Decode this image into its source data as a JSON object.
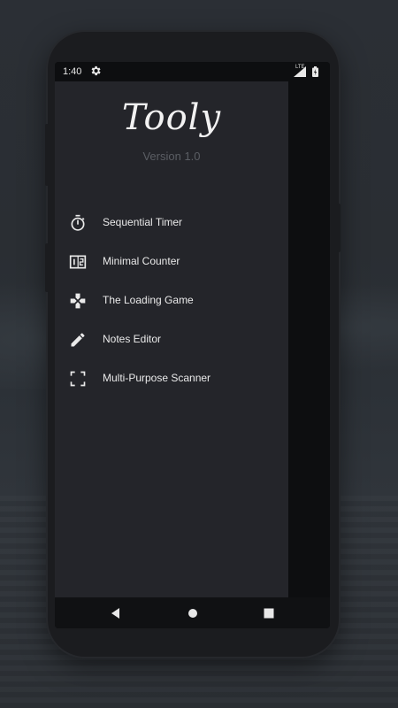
{
  "status": {
    "time": "1:40",
    "network": "LTE"
  },
  "app": {
    "title": "Tooly",
    "version": "Version 1.0"
  },
  "menu": {
    "items": [
      {
        "label": "Sequential Timer",
        "icon": "timer-icon"
      },
      {
        "label": "Minimal Counter",
        "icon": "counter-icon"
      },
      {
        "label": "The Loading Game",
        "icon": "gamepad-icon"
      },
      {
        "label": "Notes Editor",
        "icon": "pencil-icon"
      },
      {
        "label": "Multi-Purpose Scanner",
        "icon": "scanner-icon"
      }
    ]
  },
  "colors": {
    "drawer": "#24252a",
    "text": "#eaeaea",
    "version": "#5b5e64"
  }
}
